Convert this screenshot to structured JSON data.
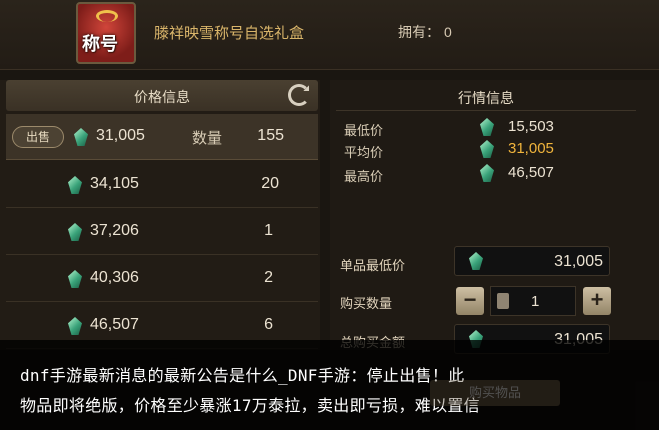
{
  "item": {
    "name": "滕祥映雪称号自选礼盒",
    "badge": "称号",
    "owned_label": "拥有：",
    "owned_count": "0"
  },
  "price_panel": {
    "title": "价格信息",
    "sell_label": "出售",
    "qty_label": "数量",
    "rows": [
      {
        "price": "31,005",
        "qty": "155"
      },
      {
        "price": "34,105",
        "qty": "20"
      },
      {
        "price": "37,206",
        "qty": "1"
      },
      {
        "price": "40,306",
        "qty": "2"
      },
      {
        "price": "46,507",
        "qty": "6"
      }
    ]
  },
  "market": {
    "title": "行情信息",
    "stats": [
      {
        "label": "最低价",
        "value": "15,503"
      },
      {
        "label": "平均价",
        "value": "31,005"
      },
      {
        "label": "最高价",
        "value": "46,507"
      }
    ],
    "unit_min_label": "单品最低价",
    "unit_min_value": "31,005",
    "buy_qty_label": "购买数量",
    "buy_qty_value": "1",
    "total_label": "总购买金额",
    "total_value": "31,005",
    "buy_button": "购买物品"
  },
  "caption": {
    "line1": "dnf手游最新消息的最新公告是什么_DNF手游：停止出售！此",
    "line2": "物品即将绝版，价格至少暴涨17万泰拉，卖出即亏损，难以置信"
  },
  "colors": {
    "accent": "#f0b43c",
    "item_name": "#d9b56a"
  }
}
